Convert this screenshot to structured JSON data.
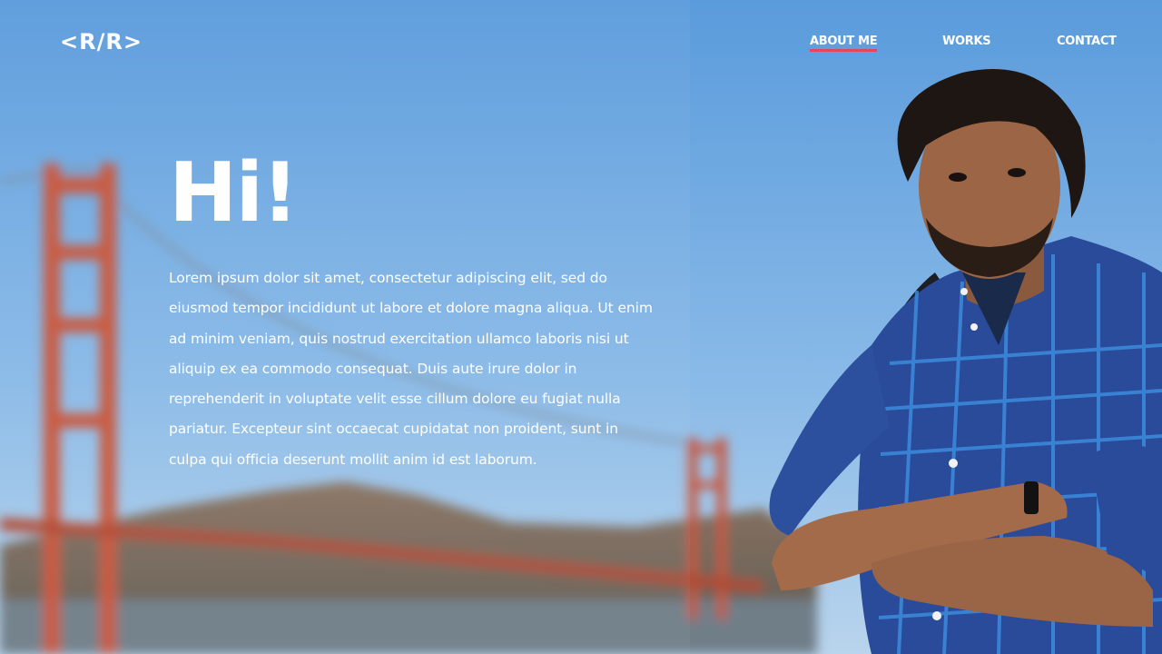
{
  "logo": {
    "text": "<R/R>"
  },
  "nav": {
    "items": [
      {
        "label": "ABOUT ME",
        "active": true
      },
      {
        "label": "WORKS",
        "active": false
      },
      {
        "label": "CONTACT",
        "active": false
      }
    ]
  },
  "hero": {
    "title": "Hi!",
    "body": "Lorem ipsum dolor sit amet, consectetur adipiscing elit, sed do eiusmod tempor incididunt ut labore et dolore magna aliqua. Ut enim ad minim veniam, quis nostrud exercitation ullamco laboris nisi ut aliquip ex ea commodo consequat. Duis aute irure dolor in reprehenderit in voluptate velit esse cillum dolore eu fugiat nulla pariatur. Excepteur sint occaecat cupidatat non proident, sunt in culpa qui officia deserunt mollit anim id est laborum."
  },
  "colors": {
    "sky_top": "#5a9bdc",
    "sky_bottom": "#a9cdee",
    "bridge": "#c8553a",
    "accent_underline": "#e0485c",
    "shirt": "#2a4a9a",
    "text": "#ffffff"
  },
  "icons": [
    "golden-gate-bridge-background",
    "person-portrait"
  ]
}
